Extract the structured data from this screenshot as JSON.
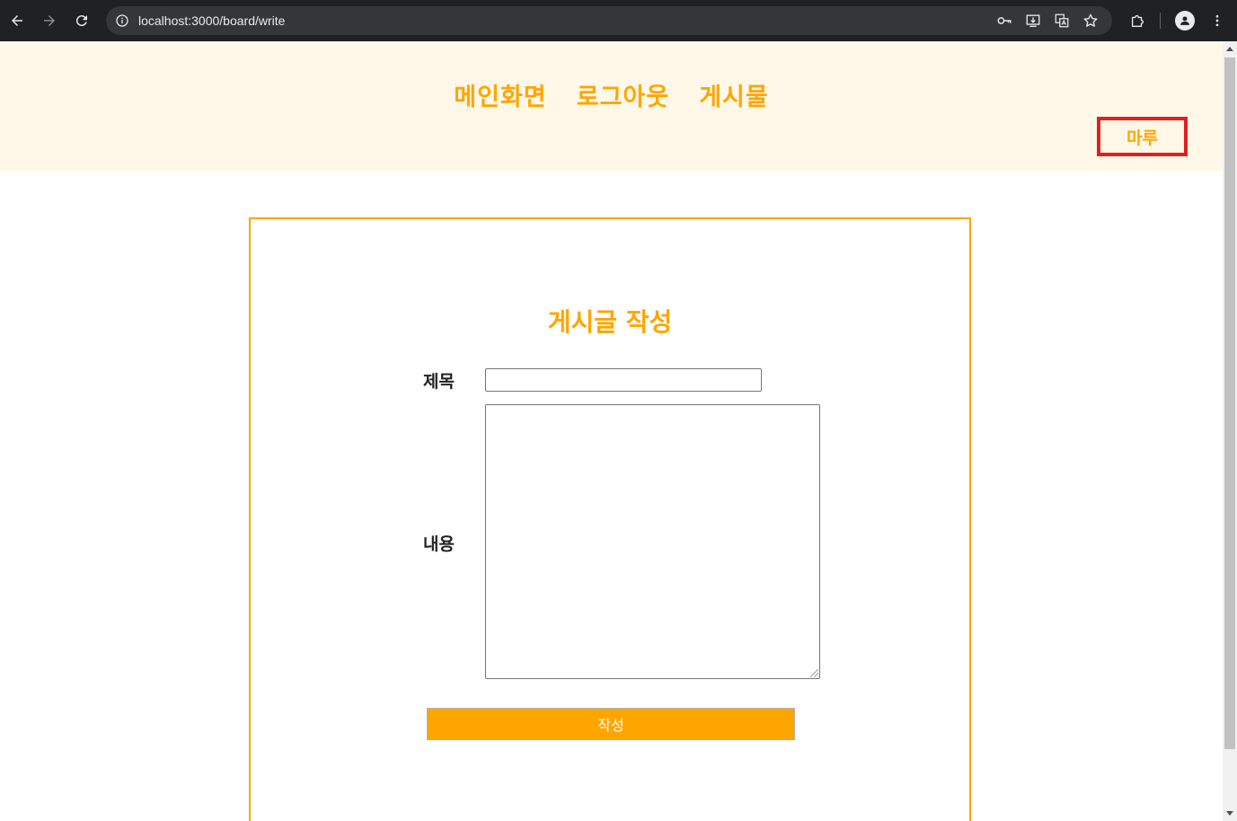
{
  "browser": {
    "url": "localhost:3000/board/write",
    "icons": [
      "back-arrow-icon",
      "forward-arrow-icon",
      "reload-icon",
      "site-info-icon",
      "password-key-icon",
      "install-app-icon",
      "translate-icon",
      "bookmark-star-icon",
      "extensions-icon",
      "profile-icon",
      "more-menu-icon"
    ]
  },
  "header": {
    "menu": [
      "메인화면",
      "로그아웃",
      "게시물"
    ],
    "user": "마루"
  },
  "form": {
    "title": "게시글 작성",
    "title_label": "제목",
    "title_value": "",
    "content_label": "내용",
    "content_value": "",
    "submit_label": "작성"
  },
  "colors": {
    "accent": "#ffa500",
    "header_bg": "#fff8e8",
    "highlight": "#e02020"
  }
}
